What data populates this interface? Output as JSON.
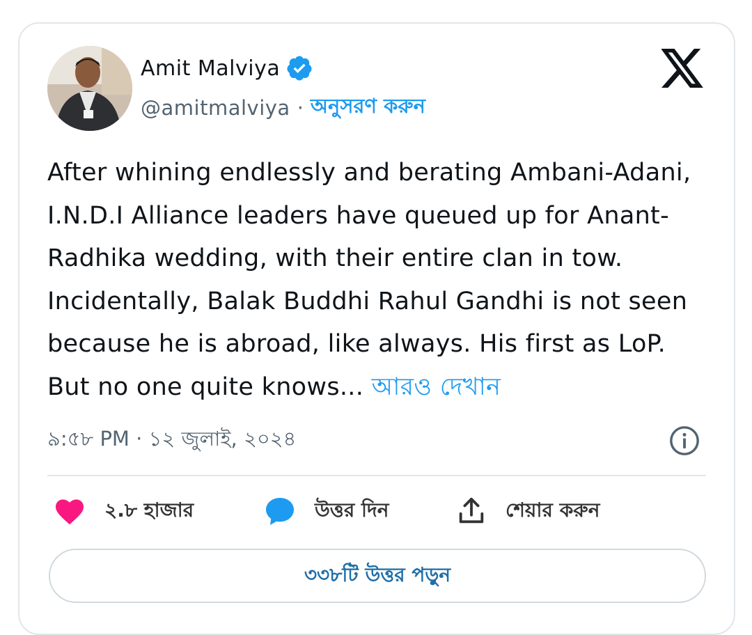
{
  "author": {
    "name": "Amit Malviya",
    "handle": "@amitmalviya",
    "separator": "·",
    "follow_label": "অনুসরণ করুন"
  },
  "tweet": {
    "text": "After whining endlessly and berating Ambani-Adani, I.N.D.I Alliance leaders have queued up for Anant-Radhika wedding, with their entire clan in tow. Incidentally, Balak Buddhi Rahul Gandhi is not seen because he is abroad, like always. His first as LoP. But no one quite knows... ",
    "show_more": "আরও দেখান",
    "timestamp": "৯:৫৮ PM · ১২ জুলাই, ২০২৪"
  },
  "actions": {
    "likes": "২.৮ হাজার",
    "reply": "উত্তর দিন",
    "share": "শেয়ার করুন"
  },
  "read_replies_label": "৩৩৮টি উত্তর পড়ুন",
  "colors": {
    "accent": "#1d9bf0",
    "like": "#f91880",
    "muted": "#536471"
  },
  "icons": [
    "verified-badge-icon",
    "x-logo-icon",
    "info-icon",
    "heart-icon",
    "reply-bubble-icon",
    "share-icon"
  ]
}
